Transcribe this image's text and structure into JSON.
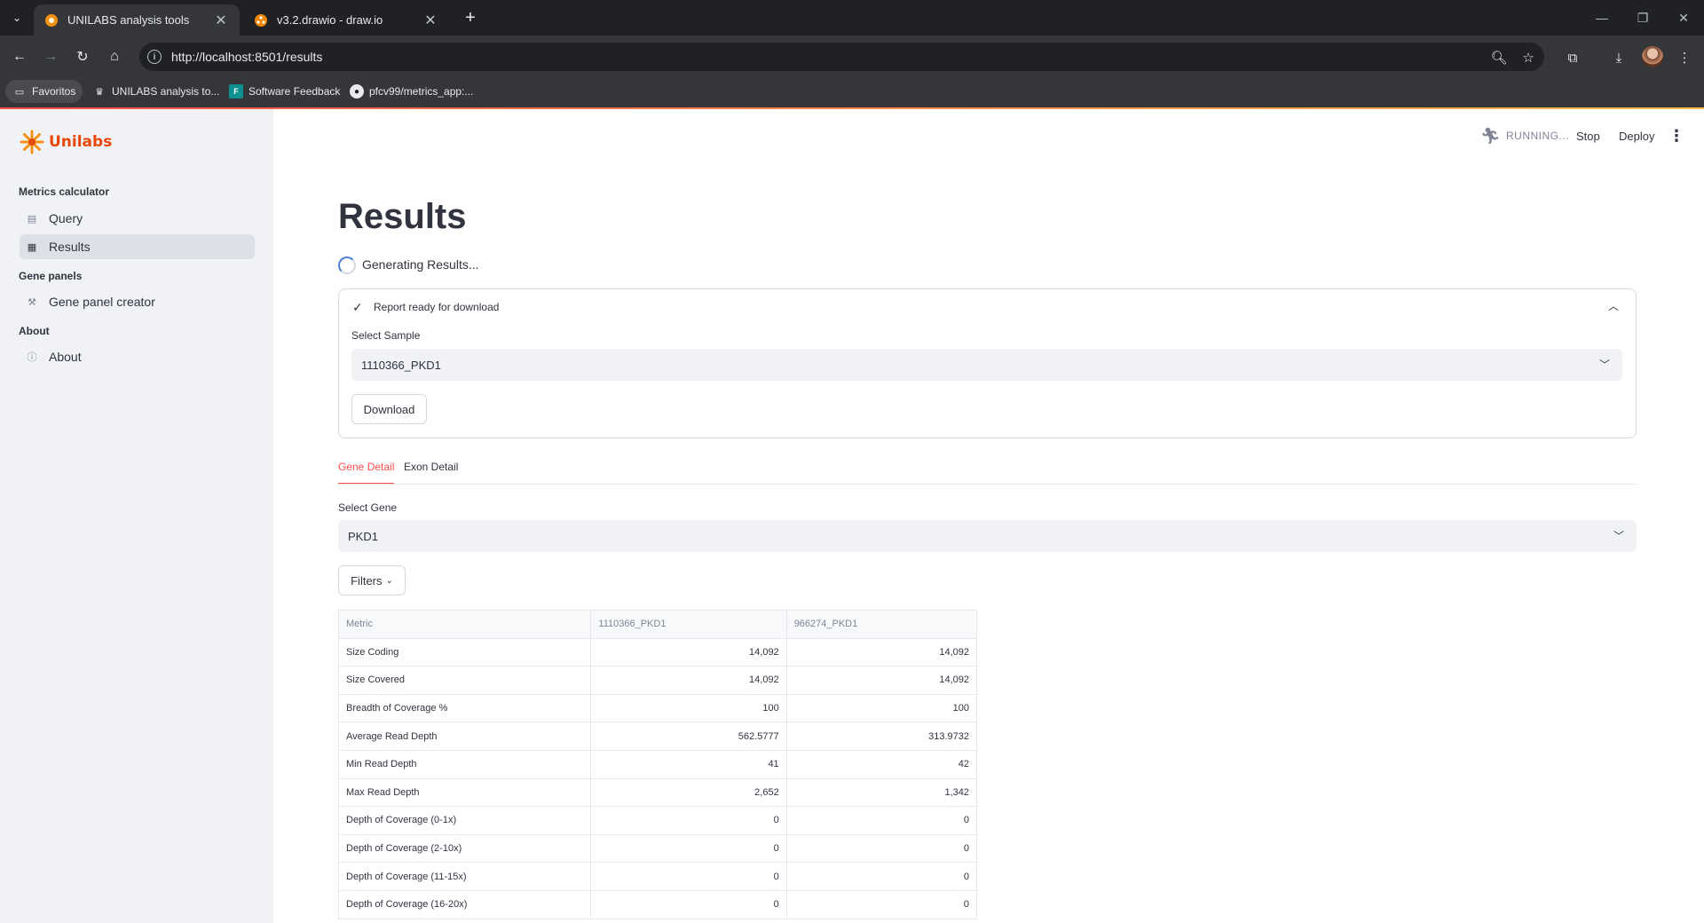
{
  "browser": {
    "tabs": [
      {
        "title": "UNILABS analysis tools",
        "active": true
      },
      {
        "title": "v3.2.drawio - draw.io",
        "active": false
      }
    ],
    "url": "http://localhost:8501/results",
    "bookmarks": [
      {
        "label": "Favoritos",
        "icon": "folder-icon"
      },
      {
        "label": "UNILABS analysis to...",
        "icon": "crown-icon"
      },
      {
        "label": "Software Feedback",
        "icon": "feedback-app-icon"
      },
      {
        "label": "pfcv99/metrics_app:...",
        "icon": "github-icon"
      }
    ]
  },
  "sidebar": {
    "logo_text": "Unilabs",
    "sections": [
      {
        "title": "Metrics calculator",
        "items": [
          {
            "label": "Query",
            "icon": "table-icon",
            "active": false
          },
          {
            "label": "Results",
            "icon": "chart-icon",
            "active": true
          }
        ]
      },
      {
        "title": "Gene panels",
        "items": [
          {
            "label": "Gene panel creator",
            "icon": "wrench-icon",
            "active": false
          }
        ]
      },
      {
        "title": "About",
        "items": [
          {
            "label": "About",
            "icon": "info-icon",
            "active": false
          }
        ]
      }
    ]
  },
  "header": {
    "status": "RUNNING...",
    "stop_label": "Stop",
    "deploy_label": "Deploy"
  },
  "main": {
    "title": "Results",
    "spinner_text": "Generating Results...",
    "expander": {
      "label": "Report ready for download",
      "select_label": "Select Sample",
      "select_value": "1110366_PKD1",
      "download_label": "Download"
    },
    "tabs": [
      {
        "label": "Gene Detail",
        "active": true
      },
      {
        "label": "Exon Detail",
        "active": false
      }
    ],
    "gene_select_label": "Select Gene",
    "gene_select_value": "PKD1",
    "filters_label": "Filters",
    "table": {
      "headers": [
        "Metric",
        "1110366_PKD1",
        "966274_PKD1"
      ],
      "rows": [
        [
          "Size Coding",
          "14,092",
          "14,092"
        ],
        [
          "Size Covered",
          "14,092",
          "14,092"
        ],
        [
          "Breadth of Coverage %",
          "100",
          "100"
        ],
        [
          "Average Read Depth",
          "562.5777",
          "313.9732"
        ],
        [
          "Min Read Depth",
          "41",
          "42"
        ],
        [
          "Max Read Depth",
          "2,652",
          "1,342"
        ],
        [
          "Depth of Coverage (0-1x)",
          "0",
          "0"
        ],
        [
          "Depth of Coverage (2-10x)",
          "0",
          "0"
        ],
        [
          "Depth of Coverage (11-15x)",
          "0",
          "0"
        ],
        [
          "Depth of Coverage (16-20x)",
          "0",
          "0"
        ]
      ]
    }
  },
  "colors": {
    "accent": "#ff4b4b",
    "brand": "#e8470a",
    "sidebar_bg": "#f0f2f6"
  }
}
